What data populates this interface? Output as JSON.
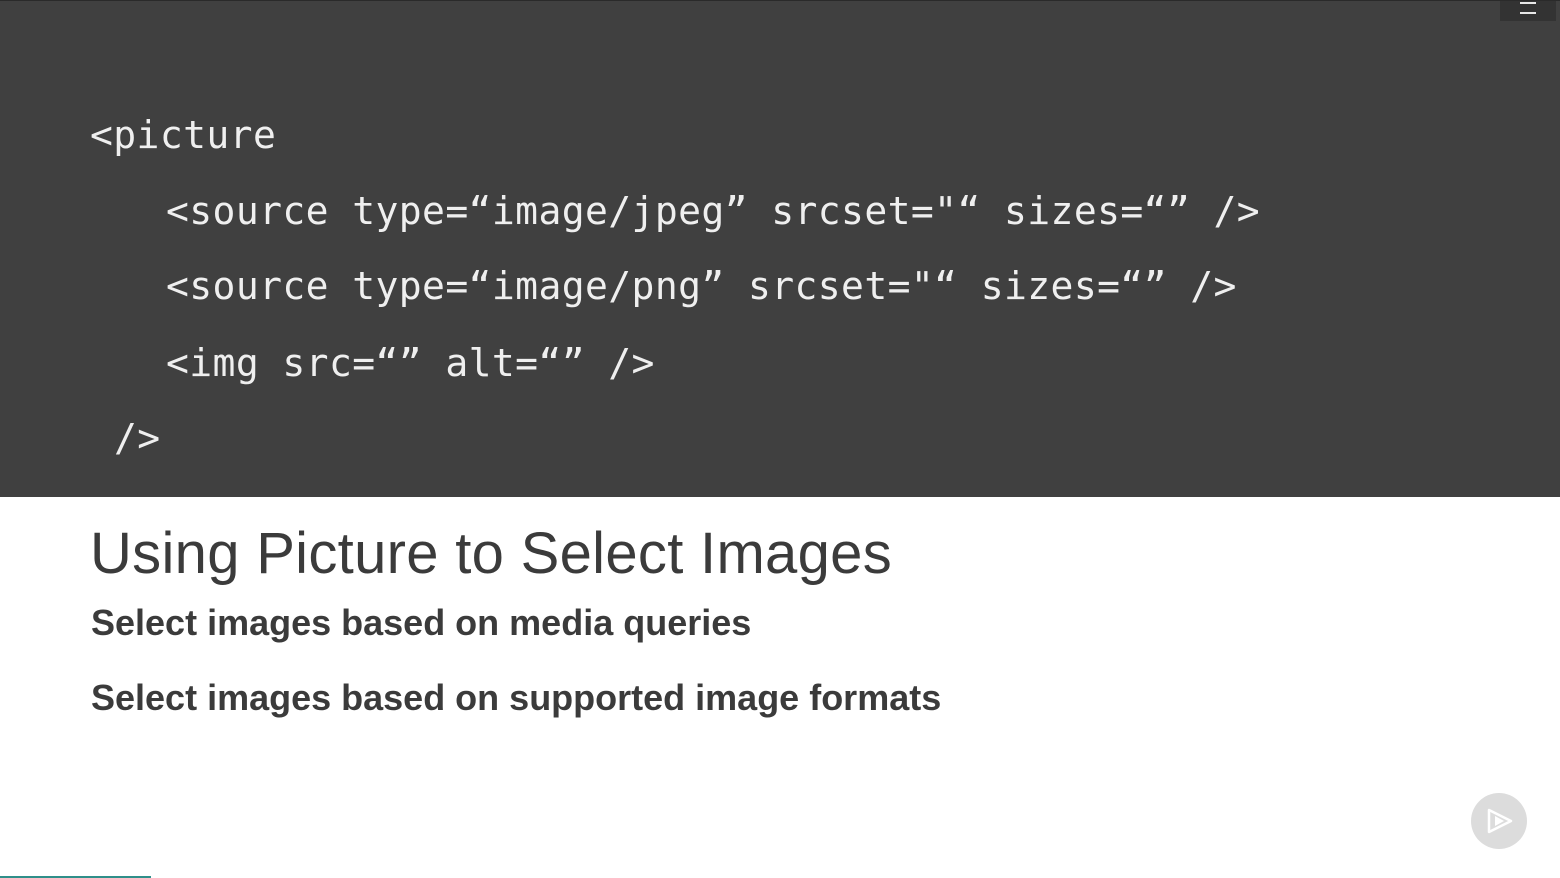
{
  "code": {
    "lines": [
      "<picture",
      "<source type=“image/jpeg” srcset=\"“ sizes=“” />",
      "<source type=“image/png” srcset=\"“ sizes=“” />",
      "<img src=“” alt=“” />",
      "/>"
    ]
  },
  "slide": {
    "title": "Using Picture to Select Images",
    "bullets": [
      "Select images based on media queries",
      "Select images based on supported image formats"
    ]
  },
  "controls": {
    "menu_icon": "hamburger-menu-icon",
    "play_icon": "play-icon"
  },
  "progress": {
    "fraction": 0.097,
    "color": "#2f8f8a"
  },
  "colors": {
    "code_background": "#404040",
    "code_text": "#efefef",
    "title_text": "#3b3b3b"
  }
}
